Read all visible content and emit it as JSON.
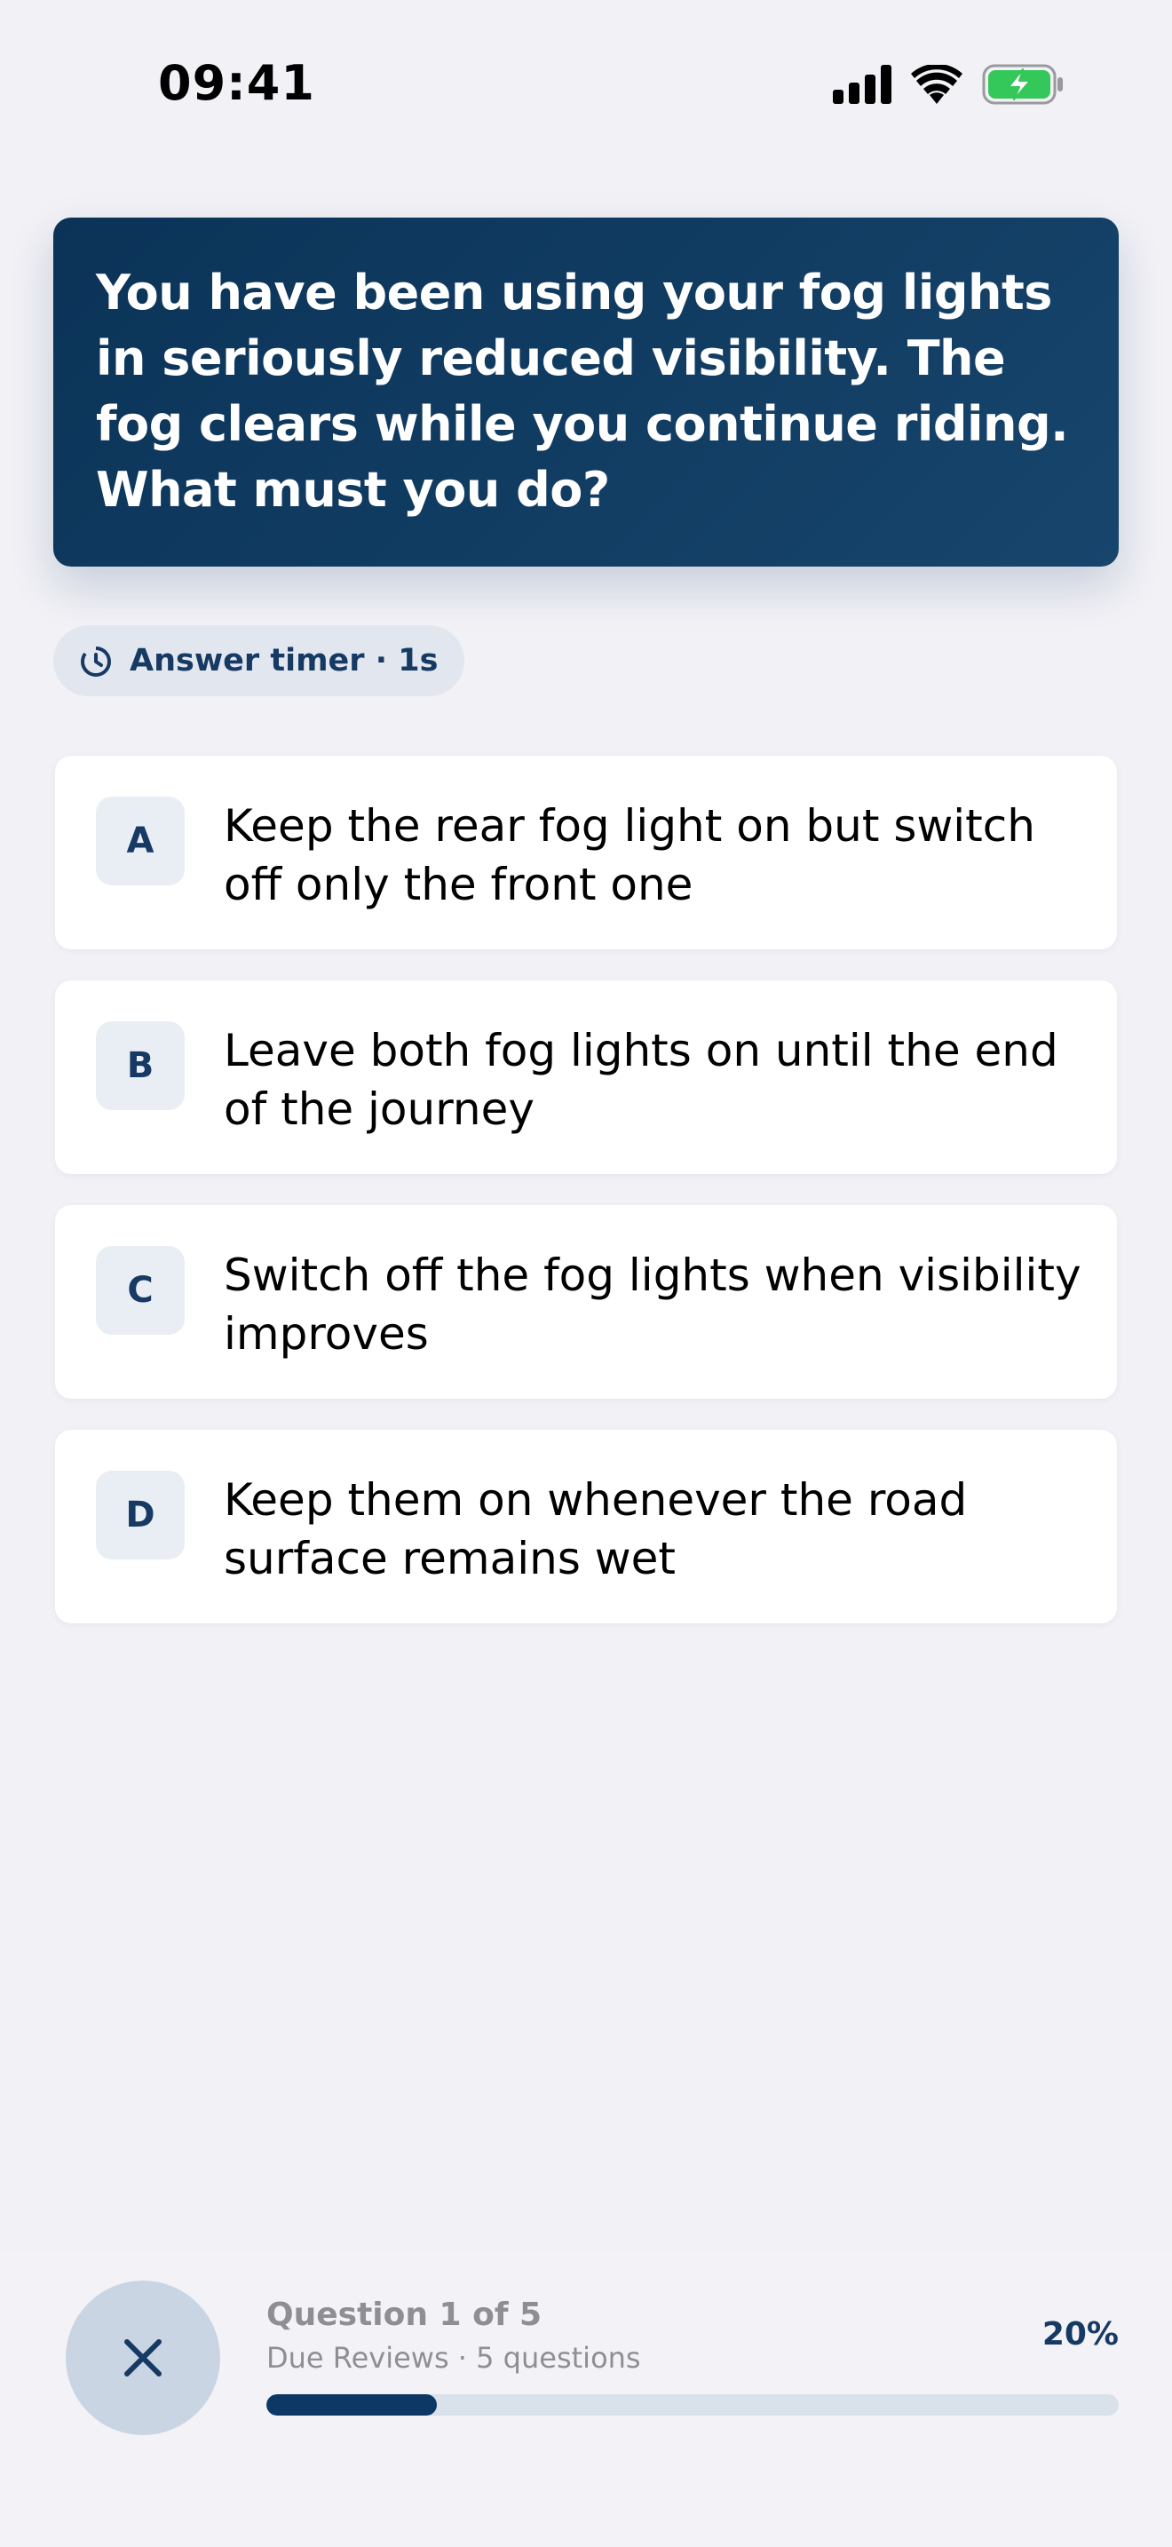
{
  "status_bar": {
    "time": "09:41",
    "icons": [
      "cellular-signal-icon",
      "wifi-icon",
      "battery-charging-icon"
    ]
  },
  "question": {
    "text": "You have been using your fog lights in seriously reduced visibility. The fog clears while you continue riding. What must you do?"
  },
  "timer": {
    "icon": "timer-icon",
    "label": "Answer timer · 1s"
  },
  "options": [
    {
      "letter": "A",
      "text": "Keep the rear fog light on but switch off only the front one"
    },
    {
      "letter": "B",
      "text": "Leave both fog lights on until the end of the journey"
    },
    {
      "letter": "C",
      "text": "Switch off the fog lights when visibility improves"
    },
    {
      "letter": "D",
      "text": "Keep them on whenever the road surface remains wet"
    }
  ],
  "footer": {
    "close_icon": "close-icon",
    "progress_title": "Question 1 of 5",
    "progress_subtitle": "Due Reviews · 5 questions",
    "progress_percent": "20%",
    "progress_fraction": 0.2
  },
  "colors": {
    "accent": "#163a63",
    "card_gradient_start": "#0b3358",
    "card_gradient_end": "#17456c",
    "progress_fill": "#0d3866",
    "battery_green": "#34c759"
  }
}
